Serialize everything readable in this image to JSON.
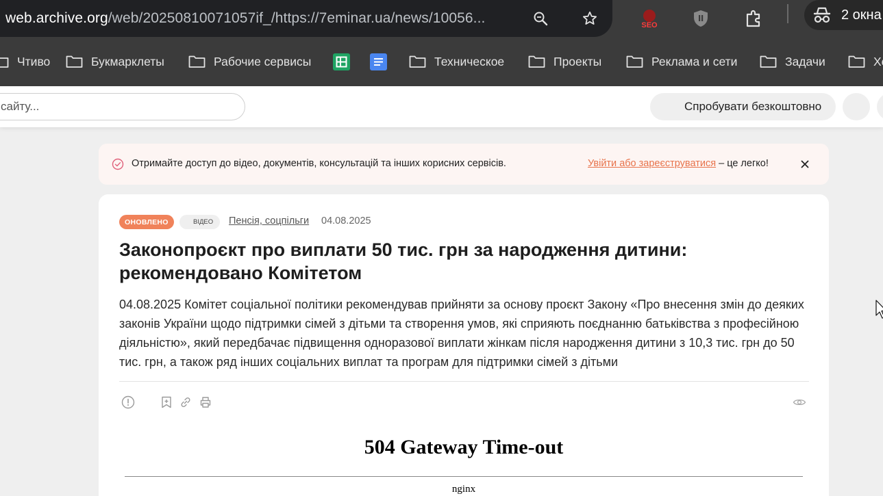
{
  "browser": {
    "url_host": "web.archive.org",
    "url_rest": "/web/20250810071057if_/https://7eminar.ua/news/10056...",
    "incognito_label": "2 окна",
    "seo_extension_label": "SEO",
    "bookmarks": [
      {
        "label": "Чтиво",
        "type": "folder"
      },
      {
        "label": "Букмарклеты",
        "type": "folder"
      },
      {
        "label": "Рабочие сервисы",
        "type": "folder"
      },
      {
        "label": "Google Таблицы",
        "type": "app",
        "icon": "sheets-icon",
        "color": "#1fa463"
      },
      {
        "label": "Google Документы",
        "type": "app",
        "icon": "docs-icon",
        "color": "#4a86f0"
      },
      {
        "label": "Техническое",
        "type": "folder"
      },
      {
        "label": "Проекты",
        "type": "folder"
      },
      {
        "label": "Реклама и сети",
        "type": "folder"
      },
      {
        "label": "Задачи",
        "type": "folder"
      },
      {
        "label": "Хе",
        "type": "folder"
      }
    ]
  },
  "site_header": {
    "search_placeholder": "сайту...",
    "try_button": "Спробувати безкоштовно"
  },
  "notice": {
    "text": "Отримайте доступ до відео, документів, консультацій та інших корисних сервісів.",
    "link": "Увійти або зареєструватися",
    "suffix": " – це легко!"
  },
  "article": {
    "badge_updated": "ОНОВЛЕНО",
    "badge_video": "ВІДЕО",
    "category": "Пенсія, соцпільги",
    "date": "04.08.2025",
    "title": "Законопроєкт про виплати 50 тис. грн за народження дитини: рекомендовано Комітетом",
    "lead": "04.08.2025 Комітет соціальної політики рекомендував прийняти за основу проєкт Закону «Про внесення змін до деяких законів України щодо підтримки сімей з дітьми та створення умов, які сприяють поєднанню батьківства з професійною діяльністю», який передбачає підвищення одноразової виплати жінкам після народження дитини з 10,3 тис. грн до 50 тис. грн, а також ряд інших соціальних виплат та програм для підтримки сімей з дітьми"
  },
  "error": {
    "title": "504 Gateway Time-out",
    "server": "nginx"
  },
  "colors": {
    "accent": "#f0825a",
    "chrome_bg": "#3b3b3b",
    "omnibox_bg": "#202124"
  }
}
